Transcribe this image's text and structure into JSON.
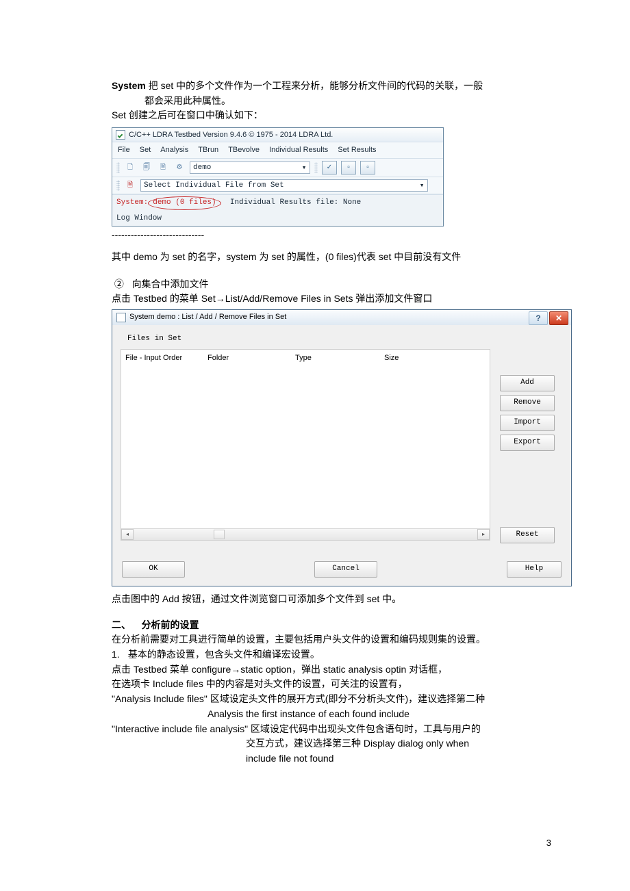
{
  "doc": {
    "p1a": "System",
    "p1b": " 把 set 中的多个文件作为一个工程来分析，能够分析文件间的代码的关联，一般",
    "p1c": "都会采用此种属性。",
    "p2": "Set 创建之后可在窗口中确认如下：",
    "sep": "-----------------------------",
    "p3": "其中 demo 为 set 的名字，system 为 set 的属性，(0 files)代表 set 中目前没有文件",
    "p4num": "②",
    "p4": "向集合中添加文件",
    "p5a": "点击 Testbed 的菜单 Set",
    "p5b": "List/Add/Remove Files in Sets  弹出添加文件窗口",
    "p6": "点击图中的 Add 按钮，通过文件浏览窗口可添加多个文件到 set 中。",
    "h2n": "二、",
    "h2": "分析前的设置",
    "p7": " 在分析前需要对工具进行简单的设置，主要包括用户头文件的设置和编码规则集的设置。",
    "p8n": "1.",
    "p8": "基本的静态设置，包含头文件和编译宏设置。",
    "p9a": "点击 Testbed 菜单 configure",
    "p9b": "static option，弹出 static analysis optin 对话框，",
    "p10": "在选项卡 Include files 中的内容是对头文件的设置，可关注的设置有，",
    "p11": "\"Analysis Include files\"  区域设定头文件的展开方式(即分不分析头文件)，建议选择第二种",
    "p11b": "Analysis the first instance of each found include",
    "p12": "\"Interactive include file analysis\"  区域设定代码中出现头文件包含语句时，工具与用户的",
    "p12b": "交互方式，建议选择第三种 Display dialog only when",
    "p12c": "include file not found",
    "page_num": "3"
  },
  "win": {
    "title": "C/C++ LDRA Testbed Version 9.4.6 © 1975 - 2014 LDRA Ltd.",
    "menus": [
      "File",
      "Set",
      "Analysis",
      "TBrun",
      "TBevolve",
      "Individual Results",
      "Set Results"
    ],
    "combo1": "demo",
    "combo2": "Select Individual File from Set",
    "status_sys": "System:",
    "status_demo": " demo (0 files)",
    "status_ind": "Individual Results file: None",
    "log": "Log Window"
  },
  "dlg": {
    "title": "System demo : List / Add / Remove Files in Set",
    "group": "Files in Set",
    "cols": [
      "File - Input Order",
      "Folder",
      "Type",
      "Size"
    ],
    "btns": {
      "add": "Add",
      "remove": "Remove",
      "import": "Import",
      "export": "Export",
      "reset": "Reset",
      "ok": "OK",
      "cancel": "Cancel",
      "help": "Help"
    }
  }
}
